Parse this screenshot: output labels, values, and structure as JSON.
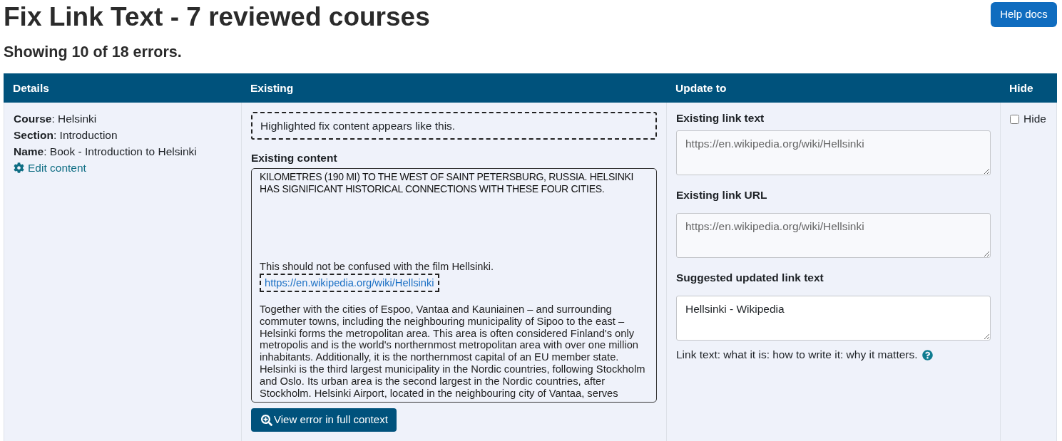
{
  "page": {
    "title": "Fix Link Text - 7 reviewed courses",
    "subtitle": "Showing 10 of 18 errors.",
    "help_button": "Help docs"
  },
  "table": {
    "columns": [
      "Details",
      "Existing",
      "Update to",
      "Hide"
    ],
    "rows": [
      {
        "details": [
          "**Course**: Helsinki",
          "**Section**: Introduction",
          "**Name**: Book - Introduction to Helsinki"
        ],
        "edit_link": "Edit content",
        "existing": {
          "legend": "Highlighted fix content appears like this.",
          "content_label": "Existing content",
          "content": [
            {
              "kind": "caps",
              "text": "KILOMETRES (190 MI) TO THE WEST OF SAINT PETERSBURG, RUSSIA. HELSINKI HAS SIGNIFICANT HISTORICAL CONNECTIONS WITH THESE FOUR CITIES."
            },
            {
              "kind": "text",
              "text": "This should not be confused with the film Hellsinki."
            },
            {
              "kind": "highlighted_link",
              "text": "https://en.wikipedia.org/wiki/Hellsinki"
            },
            {
              "kind": "text",
              "text": "Together with the cities of Espoo, Vantaa and Kauniainen – and surrounding commuter towns, including the neighbouring municipality of Sipoo to the east – Helsinki forms the metropolitan area. This area is often considered Finland's only metropolis and is the world's northernmost metropolitan area with over one million inhabitants. Additionally, it is the northernmost capital of an EU member state. Helsinki is the third largest municipality in the Nordic countries, following Stockholm and Oslo. Its urban area is the second largest in the Nordic countries, after Stockholm. Helsinki Airport, located in the neighbouring city of Vantaa, serves"
            }
          ],
          "view_button": "View error in full context"
        },
        "update": {
          "fields": [
            {
              "label": "Existing link text",
              "value": "https://en.wikipedia.org/wiki/Hellsinki",
              "disabled": true
            },
            {
              "label": "Existing link URL",
              "value": "https://en.wikipedia.org/wiki/Hellsinki",
              "disabled": true
            },
            {
              "label": "Suggested updated link text",
              "value": "Hellsinki - Wikipedia",
              "disabled": false
            }
          ],
          "help_text": "Link text: what it is: how to write it: why it matters."
        },
        "hide": {
          "label": "Hide",
          "checked": false
        }
      }
    ]
  }
}
